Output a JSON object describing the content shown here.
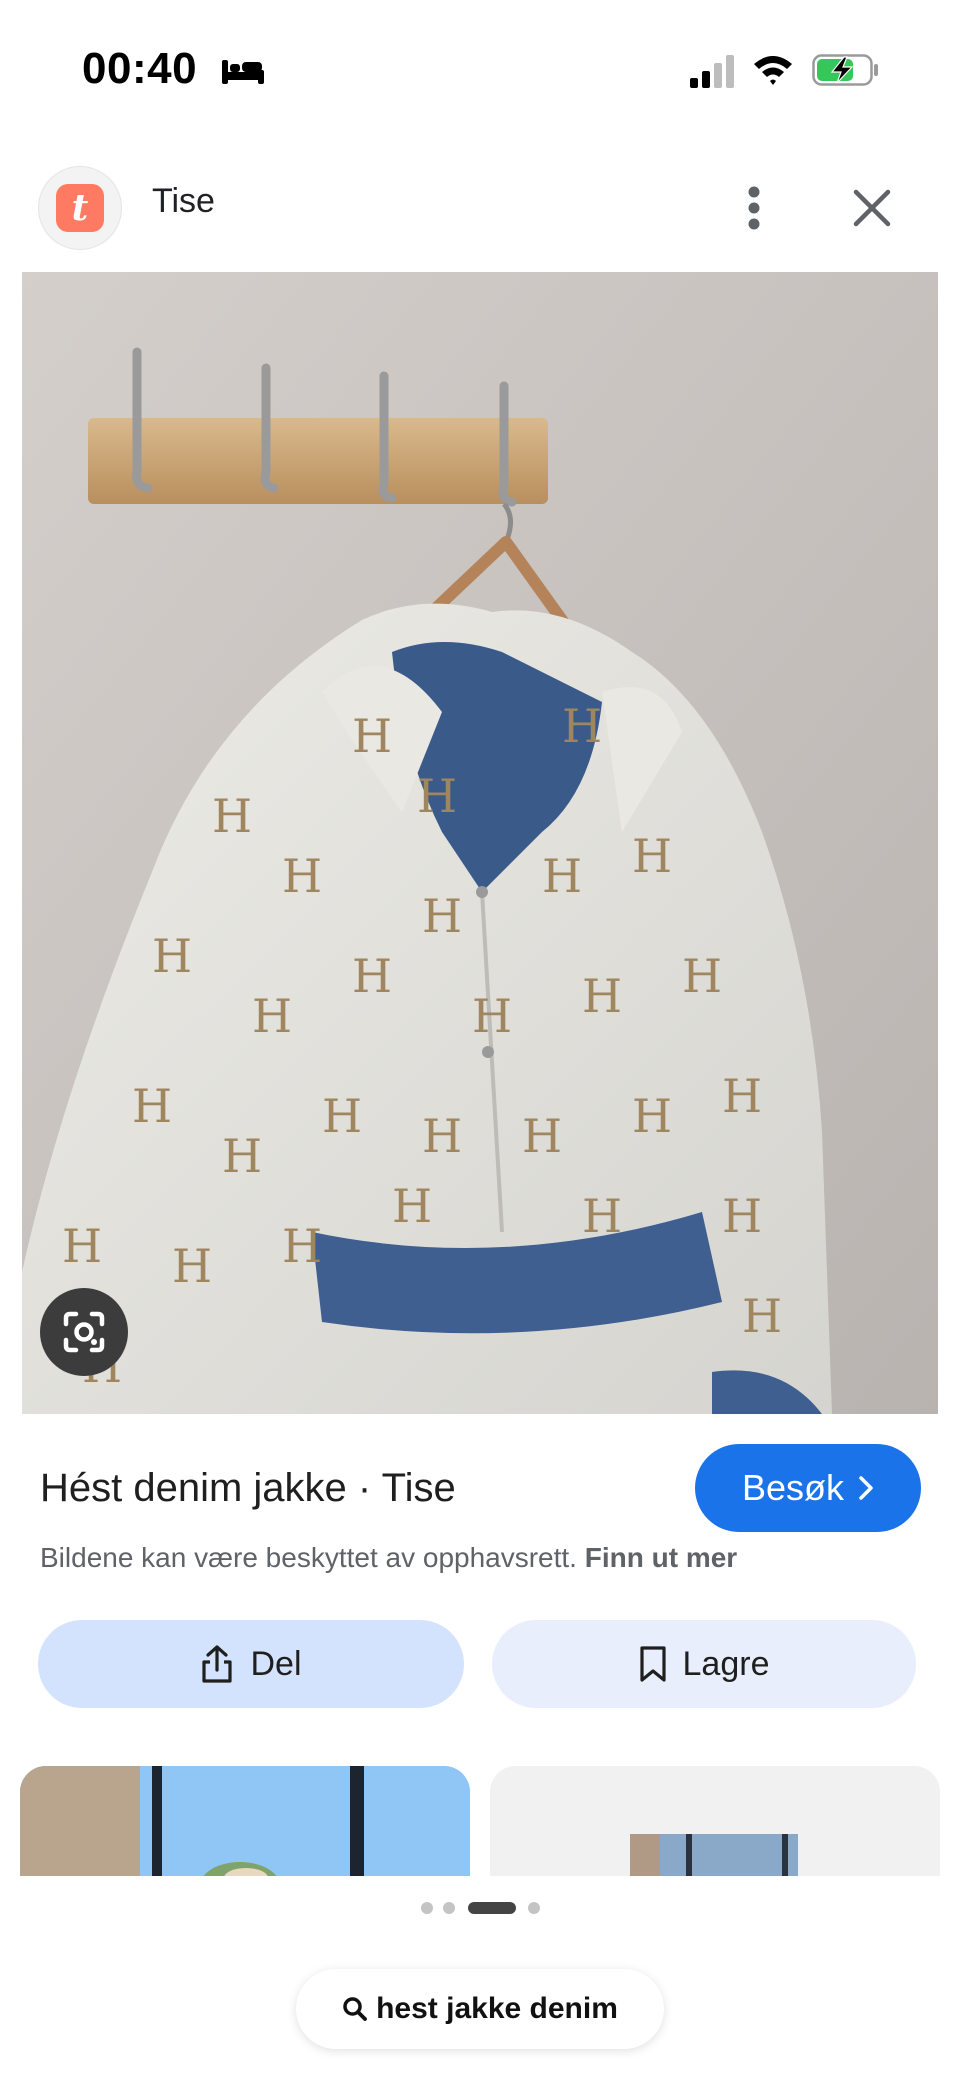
{
  "status_bar": {
    "time": "00:40",
    "sleep_icon": "bed-icon",
    "signal_icon": "cellular-signal-icon",
    "wifi_icon": "wifi-icon",
    "battery_icon": "battery-charging-icon"
  },
  "header": {
    "logo_letter": "t",
    "app_name": "Tise",
    "logo_color": "#ff7a63",
    "more_icon": "more-vertical-icon",
    "close_icon": "close-icon"
  },
  "image": {
    "lens_icon": "google-lens-icon"
  },
  "result": {
    "title": "Hést denim jakke · Tise",
    "visit_label": "Besøk",
    "visit_icon": "chevron-right-icon",
    "accent_color": "#1a73e8",
    "copyright_text": "Bildene kan være beskyttet av opphavsrett.",
    "copyright_link": "Finn ut mer"
  },
  "actions": {
    "share_label": "Del",
    "share_icon": "share-icon",
    "save_label": "Lagre",
    "save_icon": "bookmark-icon"
  },
  "pager": {
    "count": 4,
    "active_index": 2
  },
  "search_chip": {
    "query": "hest jakke denim",
    "icon": "search-icon"
  }
}
